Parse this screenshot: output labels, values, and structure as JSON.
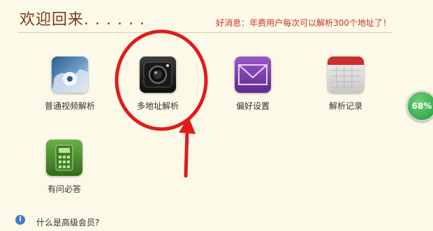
{
  "header": {
    "title": "欢迎回来. . . . . .",
    "notice": "好消息：年费用户每次可以解析300个地址了！"
  },
  "tiles": [
    {
      "label": "普通视频解析",
      "icon": "video-icon"
    },
    {
      "label": "多地址解析",
      "icon": "camera-icon"
    },
    {
      "label": "偏好设置",
      "icon": "envelope-icon"
    },
    {
      "label": "解析记录",
      "icon": "calendar-icon"
    },
    {
      "label": "有问必答",
      "icon": "calculator-icon"
    }
  ],
  "footer": {
    "info_icon": "i",
    "link": "什么是高级会员?"
  },
  "progress": {
    "text": "68%",
    "value": 0.68
  },
  "annotation": {
    "color": "#e01b1b"
  }
}
